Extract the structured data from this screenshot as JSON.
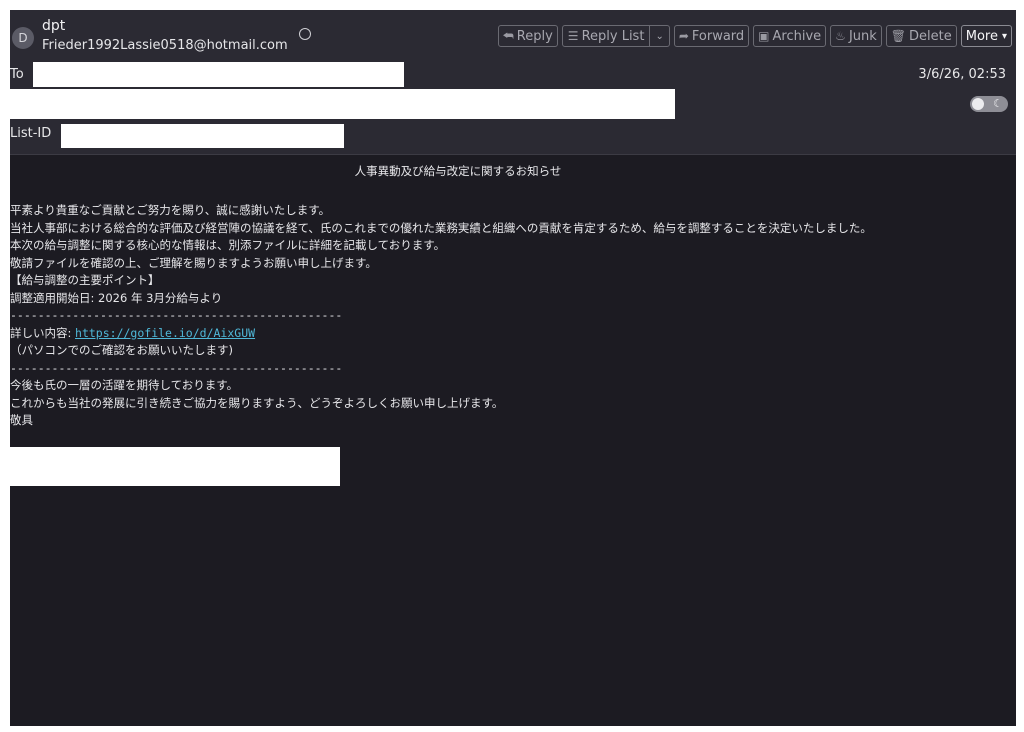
{
  "sender": {
    "initial": "D",
    "name": "dpt",
    "email": "Frieder1992Lassie0518@hotmail.com",
    "icon": "contact-icon"
  },
  "toolbar": {
    "reply": {
      "label": "Reply",
      "icon": "reply-icon"
    },
    "reply_list": {
      "label": "Reply List",
      "icon": "reply-list-icon"
    },
    "forward": {
      "label": "Forward",
      "icon": "forward-icon"
    },
    "archive": {
      "label": "Archive",
      "icon": "archive-icon"
    },
    "junk": {
      "label": "Junk",
      "icon": "junk-icon"
    },
    "delete": {
      "label": "Delete",
      "icon": "trash-icon"
    },
    "more": {
      "label": "More"
    }
  },
  "headers": {
    "to_label": "To",
    "list_id_label": "List-ID",
    "date": "3/6/26, 02:53"
  },
  "message": {
    "subject": "人事異動及び給与改定に関するお知らせ",
    "lines": [
      "平素より貴重なご貢献とご努力を賜り、誠に感謝いたします。",
      "当社人事部における総合的な評価及び経営陣の協議を経て、氏のこれまでの優れた業務実績と組織への貢献を肯定するため、給与を調整することを決定いたしました。",
      "本次の給与調整に関する核心的な情報は、別添ファイルに詳細を記載しております。",
      "敬請ファイルを確認の上、ご理解を賜りますようお願い申し上げます。",
      "【給与調整の主要ポイント】",
      "調整適用開始日: 2026 年 3月分給与より"
    ],
    "separator": "------------------------------------------------",
    "details_label": "詳しい内容: ",
    "link": "https://gofile.io/d/AixGUW",
    "pc_note": "（パソコンでのご確認をお願いいたします)",
    "closing": [
      "今後も氏の一層の活躍を期待しております。",
      "これからも当社の発展に引き続きご協力を賜りますよう、どうぞよろしくお願い申し上げます。",
      "敬具"
    ]
  }
}
